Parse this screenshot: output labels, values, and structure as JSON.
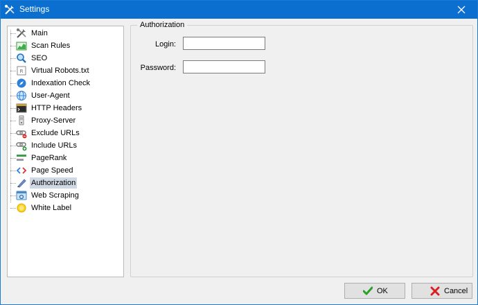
{
  "window": {
    "title": "Settings",
    "accent": "#0b6fd0"
  },
  "tree": {
    "items": [
      {
        "label": "Main",
        "icon": "tools-icon"
      },
      {
        "label": "Scan Rules",
        "icon": "chart-icon"
      },
      {
        "label": "SEO",
        "icon": "magnifier-icon"
      },
      {
        "label": "Virtual Robots.txt",
        "icon": "robot-file-icon"
      },
      {
        "label": "Indexation Check",
        "icon": "compass-icon"
      },
      {
        "label": "User-Agent",
        "icon": "globe-icon"
      },
      {
        "label": "HTTP Headers",
        "icon": "terminal-icon"
      },
      {
        "label": "Proxy-Server",
        "icon": "server-icon"
      },
      {
        "label": "Exclude URLs",
        "icon": "link-exclude-icon"
      },
      {
        "label": "Include URLs",
        "icon": "link-include-icon"
      },
      {
        "label": "PageRank",
        "icon": "bars-icon"
      },
      {
        "label": "Page Speed",
        "icon": "code-icon"
      },
      {
        "label": "Authorization",
        "icon": "pen-icon",
        "selected": true
      },
      {
        "label": "Web Scraping",
        "icon": "scraper-icon"
      },
      {
        "label": "White Label",
        "icon": "sun-icon"
      }
    ]
  },
  "panel": {
    "group_title": "Authorization",
    "login_label": "Login:",
    "login_value": "",
    "password_label": "Password:",
    "password_value": ""
  },
  "buttons": {
    "ok_label": "OK",
    "cancel_label": "Cancel"
  }
}
